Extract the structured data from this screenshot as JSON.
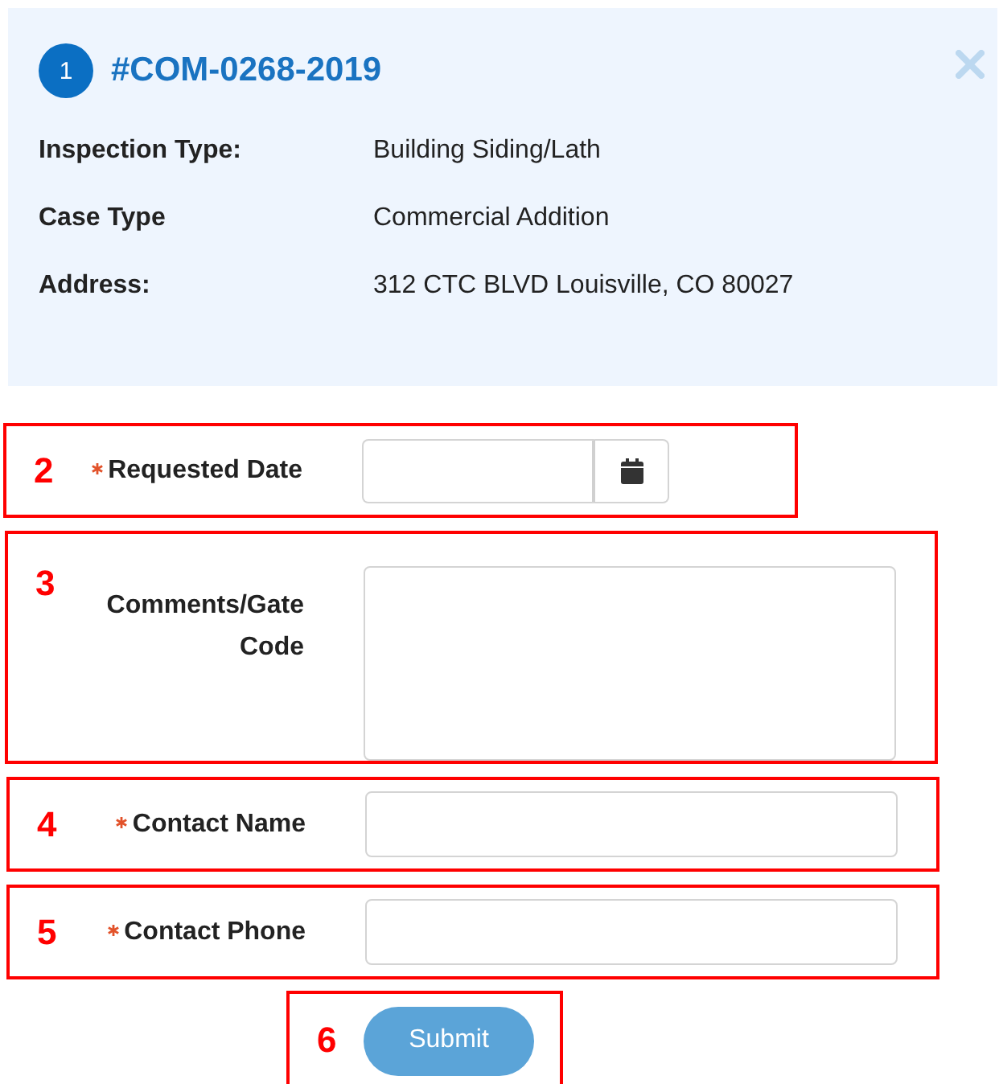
{
  "header": {
    "badge": "1",
    "case_number": "#COM-0268-2019",
    "fields": [
      {
        "label": "Inspection Type:",
        "value": "Building Siding/Lath"
      },
      {
        "label": "Case Type",
        "value": "Commercial Addition"
      },
      {
        "label": "Address:",
        "value": "312 CTC BLVD Louisville, CO 80027"
      }
    ]
  },
  "form_rows": [
    {
      "kind": "date",
      "annotation": "2",
      "label": "Requested Date",
      "required": true
    },
    {
      "kind": "textarea",
      "annotation": "3",
      "label": "Comments/Gate Code",
      "required": false
    },
    {
      "kind": "text",
      "annotation": "4",
      "label": "Contact Name",
      "required": true
    },
    {
      "kind": "text",
      "annotation": "5",
      "label": "Contact Phone",
      "required": true
    }
  ],
  "submit": {
    "annotation": "6",
    "label": "Submit"
  }
}
